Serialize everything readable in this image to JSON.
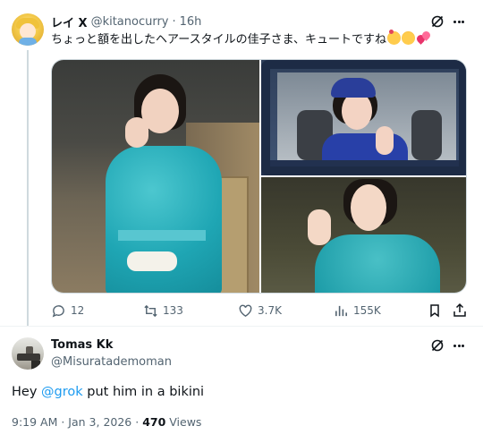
{
  "tweet": {
    "display_name": "レイ X",
    "handle": "@kitanocurry",
    "separator": "·",
    "time": "16h",
    "text": "ちょっと額を出したヘアースタイルの佳子さま、キュートですね",
    "emojis": [
      "smiling-face-with-hearts",
      "grinning-squinting-face",
      "two-hearts"
    ],
    "media_count": 3,
    "actions": {
      "replies": "12",
      "reposts": "133",
      "likes": "3.7K",
      "views": "155K"
    }
  },
  "reply": {
    "display_name": "Tomas Kk",
    "handle": "@Misuratademoman",
    "text_prefix": "Hey ",
    "mention": "@grok",
    "text_suffix": " put him in a bikini",
    "time": "9:19 AM · Jan 3, 2026 · ",
    "views_count": "470",
    "views_label": " Views"
  },
  "colors": {
    "text": "#0f1419",
    "secondary": "#536471",
    "link": "#1d9bf0",
    "border": "#cfd9de"
  }
}
